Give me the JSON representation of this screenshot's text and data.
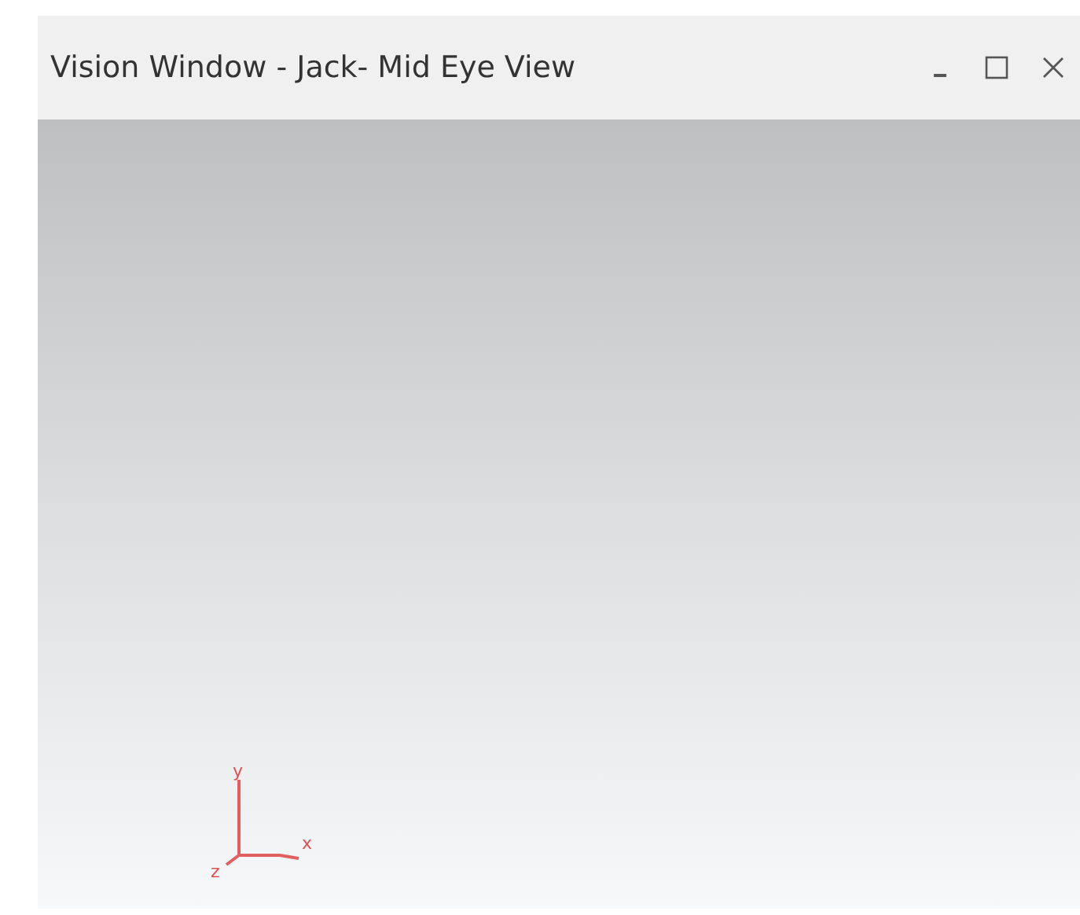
{
  "window": {
    "title": "Vision Window - Jack- Mid Eye View"
  },
  "viewport": {
    "axes": [
      {
        "kind": "y",
        "label": "y"
      },
      {
        "kind": "x",
        "label": "x"
      },
      {
        "kind": "z",
        "label": "z"
      }
    ]
  }
}
